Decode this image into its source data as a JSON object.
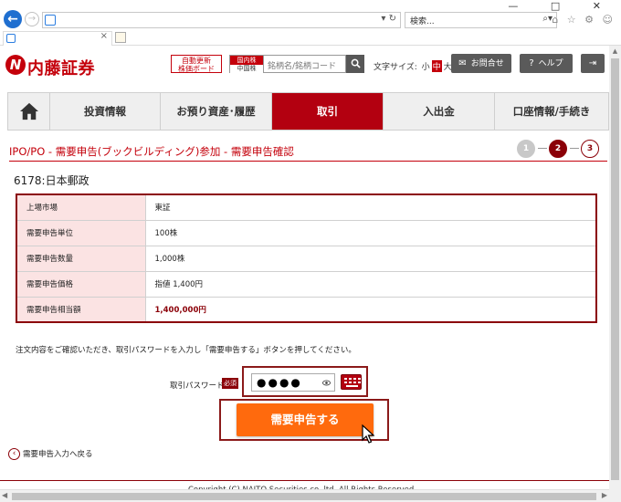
{
  "browser": {
    "search_placeholder": "検索...",
    "window_controls": "— □ ✕",
    "toolbar_icons": "⌂ ☆ ⚙ ☺"
  },
  "header": {
    "logo_text": "内藤証券",
    "auto_update_board": "自動更新\n株価ボード",
    "market_tab_active": "国内株",
    "market_tab_inactive": "中国株",
    "stock_search_placeholder": "銘柄名/銘柄コード",
    "font_size_label": "文字サイズ:",
    "font_size_options": [
      "小",
      "中",
      "大"
    ],
    "inquiry_button": "お問合せ",
    "help_button": "ヘルプ"
  },
  "nav": {
    "items": [
      {
        "label": "投資情報"
      },
      {
        "label": "お預り資産･履歴"
      },
      {
        "label": "取引",
        "active": true
      },
      {
        "label": "入出金"
      },
      {
        "label": "口座情報/手続き"
      }
    ]
  },
  "page": {
    "title": "IPO/PO - 需要申告(ブックビルディング)参加 - 需要申告確認",
    "steps": [
      "1",
      "2",
      "3"
    ],
    "current_step": 2,
    "stock_title": "6178:日本郵政"
  },
  "details": [
    {
      "label": "上場市場",
      "value": "東証"
    },
    {
      "label": "需要申告単位",
      "value": "100株"
    },
    {
      "label": "需要申告数量",
      "value": "1,000株"
    },
    {
      "label": "需要申告価格",
      "value": "指値 1,400円"
    },
    {
      "label": "需要申告相当額",
      "value": "1,400,000円"
    }
  ],
  "form": {
    "instruction": "注文内容をご確認いただき、取引パスワードを入力し「需要申告する」ボタンを押してください。",
    "password_label": "取引パスワード",
    "required_badge": "必須",
    "password_value": "●●●●",
    "submit_label": "需要申告する",
    "back_link": "需要申告入力へ戻る"
  },
  "footer": {
    "copyright": "Copyright (C) NAITO Securities co.,ltd. All Rights Reserved."
  },
  "colors": {
    "brand": "#c4000b",
    "nav_active": "#b30010",
    "submit": "#ff6a0d",
    "label_bg": "#fbe3e3"
  }
}
